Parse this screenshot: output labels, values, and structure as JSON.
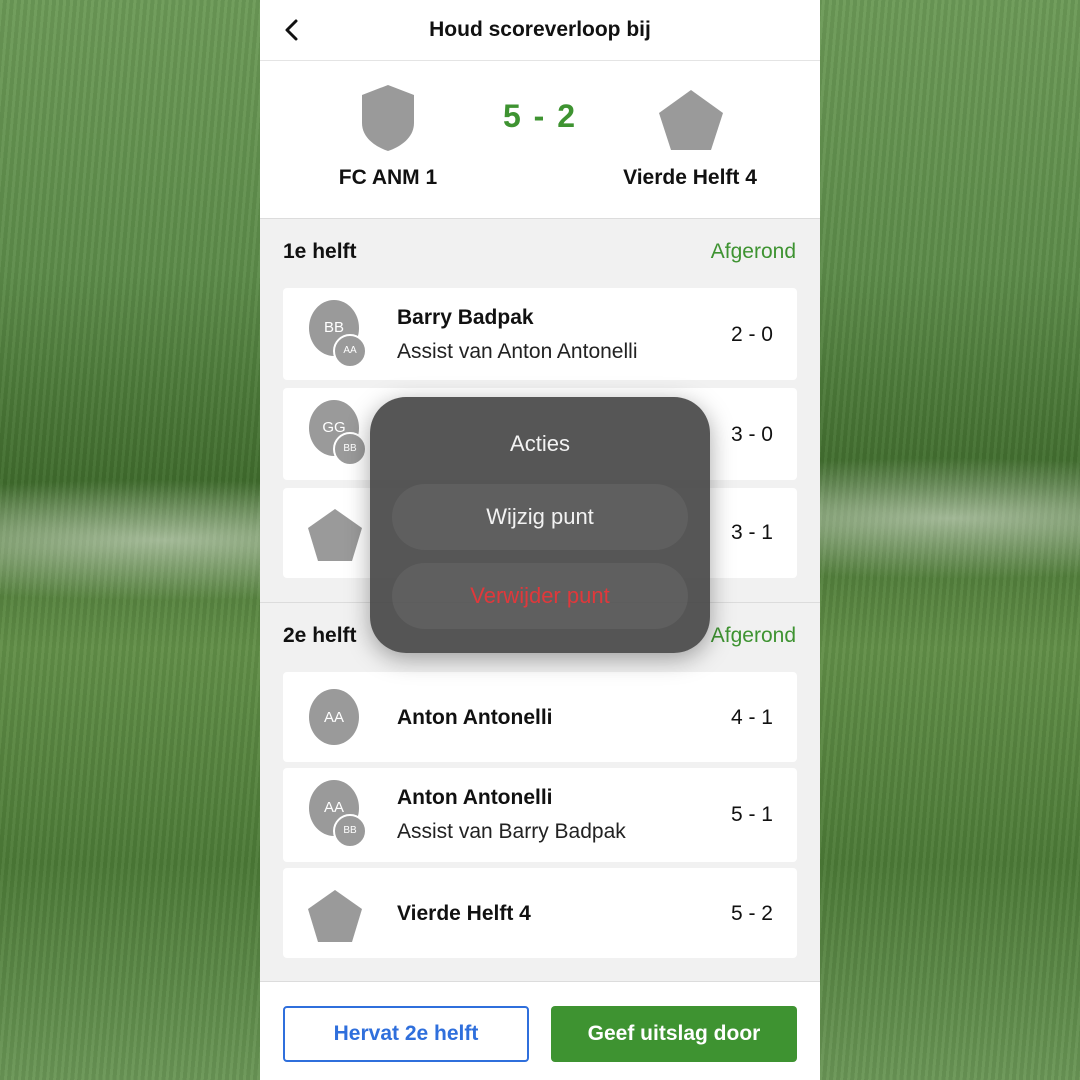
{
  "header": {
    "title": "Houd scoreverloop bij"
  },
  "match": {
    "home": "FC ANM 1",
    "away": "Vierde Helft 4",
    "score": "5 - 2"
  },
  "halves": [
    {
      "title": "1e helft",
      "status": "Afgerond",
      "events": [
        {
          "avatar": "BB",
          "mini": "AA",
          "player": "Barry Badpak",
          "assist": "Assist van Anton Antonelli",
          "score": "2 - 0"
        },
        {
          "avatar": "GG",
          "mini": "BB",
          "player": "",
          "assist": "",
          "score": "3 - 0"
        },
        {
          "crest": "pentagon-icon",
          "player": "",
          "score": "3 - 1"
        }
      ]
    },
    {
      "title": "2e helft",
      "status": "Afgerond",
      "events": [
        {
          "avatar": "AA",
          "player": "Anton Antonelli",
          "score": "4 - 1"
        },
        {
          "avatar": "AA",
          "mini": "BB",
          "player": "Anton Antonelli",
          "assist": "Assist van Barry Badpak",
          "score": "5 - 1"
        },
        {
          "crest": "pentagon-icon",
          "player": "Vierde Helft 4",
          "score": "5 - 2"
        }
      ]
    }
  ],
  "footer": {
    "resume_label": "Hervat 2e helft",
    "submit_label": "Geef uitslag door"
  },
  "actions_sheet": {
    "title": "Acties",
    "edit_label": "Wijzig punt",
    "delete_label": "Verwijder punt"
  },
  "colors": {
    "accent_green": "#3e9331",
    "accent_blue": "#2f6fdc",
    "danger": "#e0383b"
  }
}
